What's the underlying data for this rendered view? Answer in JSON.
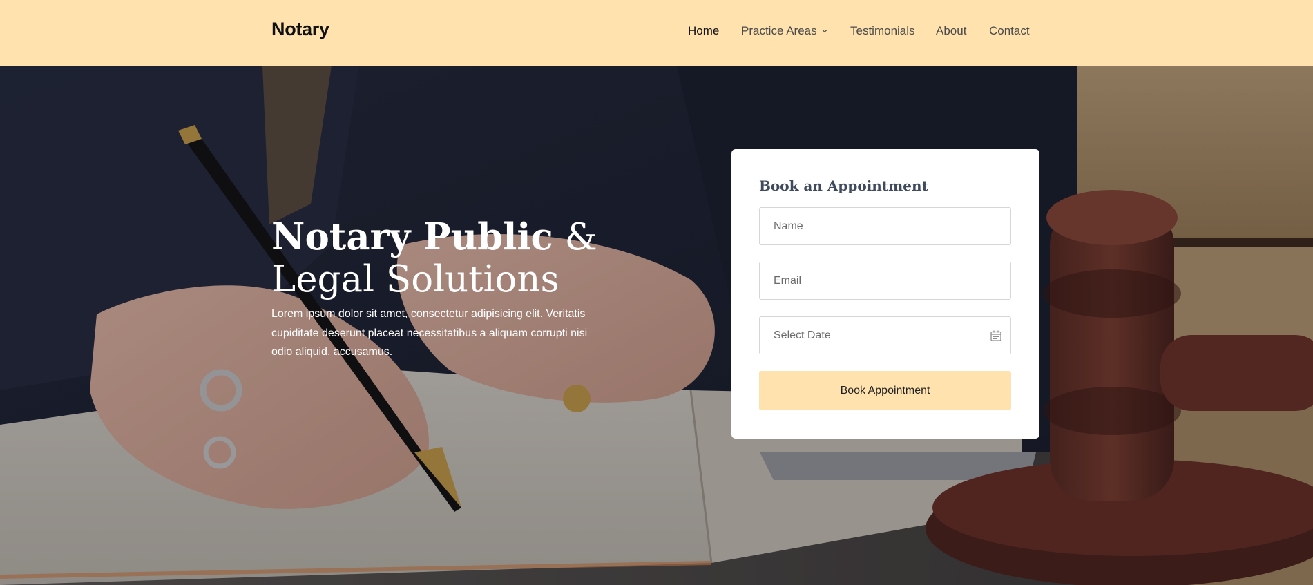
{
  "brand": "Notary",
  "nav": {
    "items": [
      {
        "label": "Home",
        "active": true
      },
      {
        "label": "Practice Areas",
        "has_dropdown": true
      },
      {
        "label": "Testimonials"
      },
      {
        "label": "About"
      },
      {
        "label": "Contact"
      }
    ]
  },
  "hero": {
    "title_line1_bold": "Notary Public",
    "title_amp": " &",
    "title_line2": "Legal Solutions",
    "text": "Lorem ipsum dolor sit amet, consectetur adipisicing elit. Veritatis cupiditate deserunt placeat necessitatibus a aliquam corrupti nisi odio aliquid, accusamus."
  },
  "form": {
    "title": "Book an Appointment",
    "name_placeholder": "Name",
    "email_placeholder": "Email",
    "date_placeholder": "Select Date",
    "submit_label": "Book Appointment"
  },
  "colors": {
    "nav_bg": "#ffe2ae",
    "button_bg": "#ffe2ae",
    "card_bg": "#ffffff"
  },
  "icons": {
    "dropdown": "chevron-down-icon",
    "date": "calendar-icon"
  }
}
